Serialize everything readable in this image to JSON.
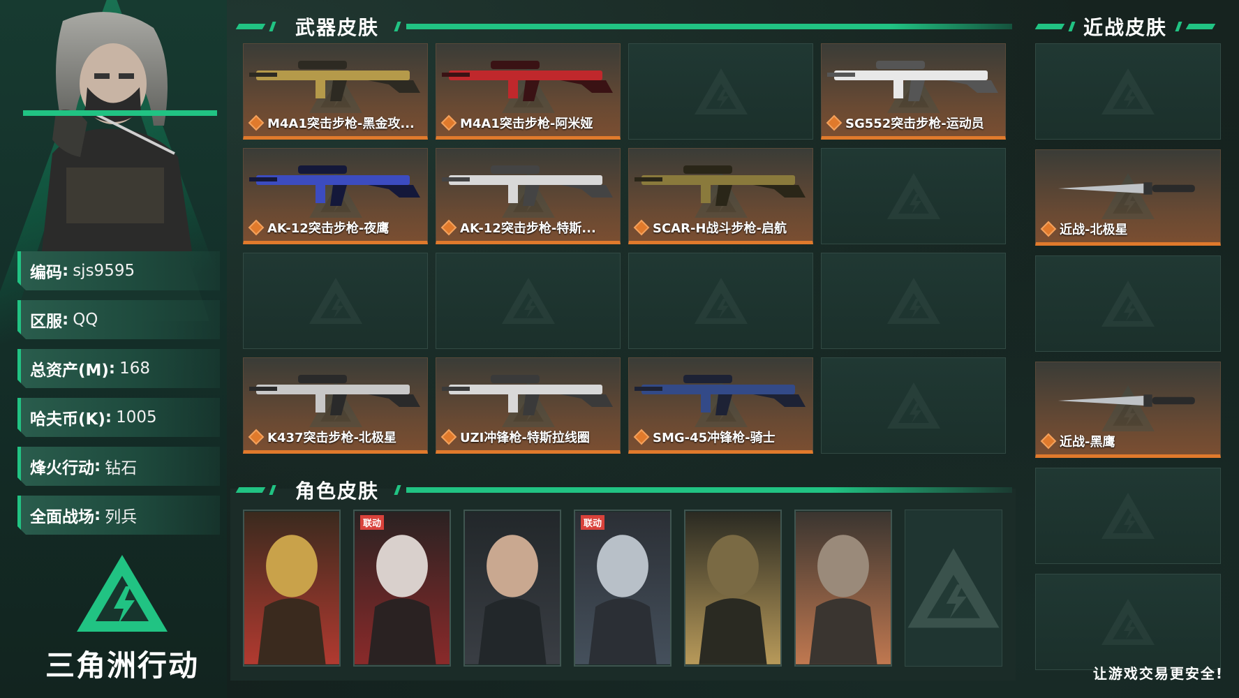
{
  "profile": {
    "rows": [
      {
        "key": "编码",
        "value": "sjs9595"
      },
      {
        "key": "区服",
        "value": "QQ"
      },
      {
        "key": "总资产(M)",
        "value": "168"
      },
      {
        "key": "哈夫币(K)",
        "value": "1005"
      },
      {
        "key": "烽火行动",
        "value": "钻石"
      },
      {
        "key": "全面战场",
        "value": "列兵"
      }
    ],
    "separator": ": "
  },
  "logo": {
    "text": "三角洲行动"
  },
  "sections": {
    "weapons": "武器皮肤",
    "melee": "近战皮肤",
    "characters": "角色皮肤"
  },
  "weapons": [
    "M4A1突击步枪-黑金攻...",
    "M4A1突击步枪-阿米娅",
    "",
    "SG552突击步枪-运动员",
    "AK-12突击步枪-夜鹰",
    "AK-12突击步枪-特斯...",
    "SCAR-H战斗步枪-启航",
    "",
    "",
    "",
    "",
    "",
    "K437突击步枪-北极星",
    "UZI冲锋枪-特斯拉线圈",
    "SMG-45冲锋枪-骑士",
    ""
  ],
  "melee": [
    "",
    "近战-北极星",
    "",
    "近战-黑鹰",
    "",
    ""
  ],
  "characters": {
    "collab_label": "联动",
    "cards": [
      {
        "collab": false
      },
      {
        "collab": true
      },
      {
        "collab": false
      },
      {
        "collab": true
      },
      {
        "collab": false
      },
      {
        "collab": false
      },
      {
        "empty": true
      }
    ]
  },
  "footer": "让游戏交易更安全!",
  "colors": {
    "accent": "#21c383",
    "orange": "#e07a2c"
  }
}
